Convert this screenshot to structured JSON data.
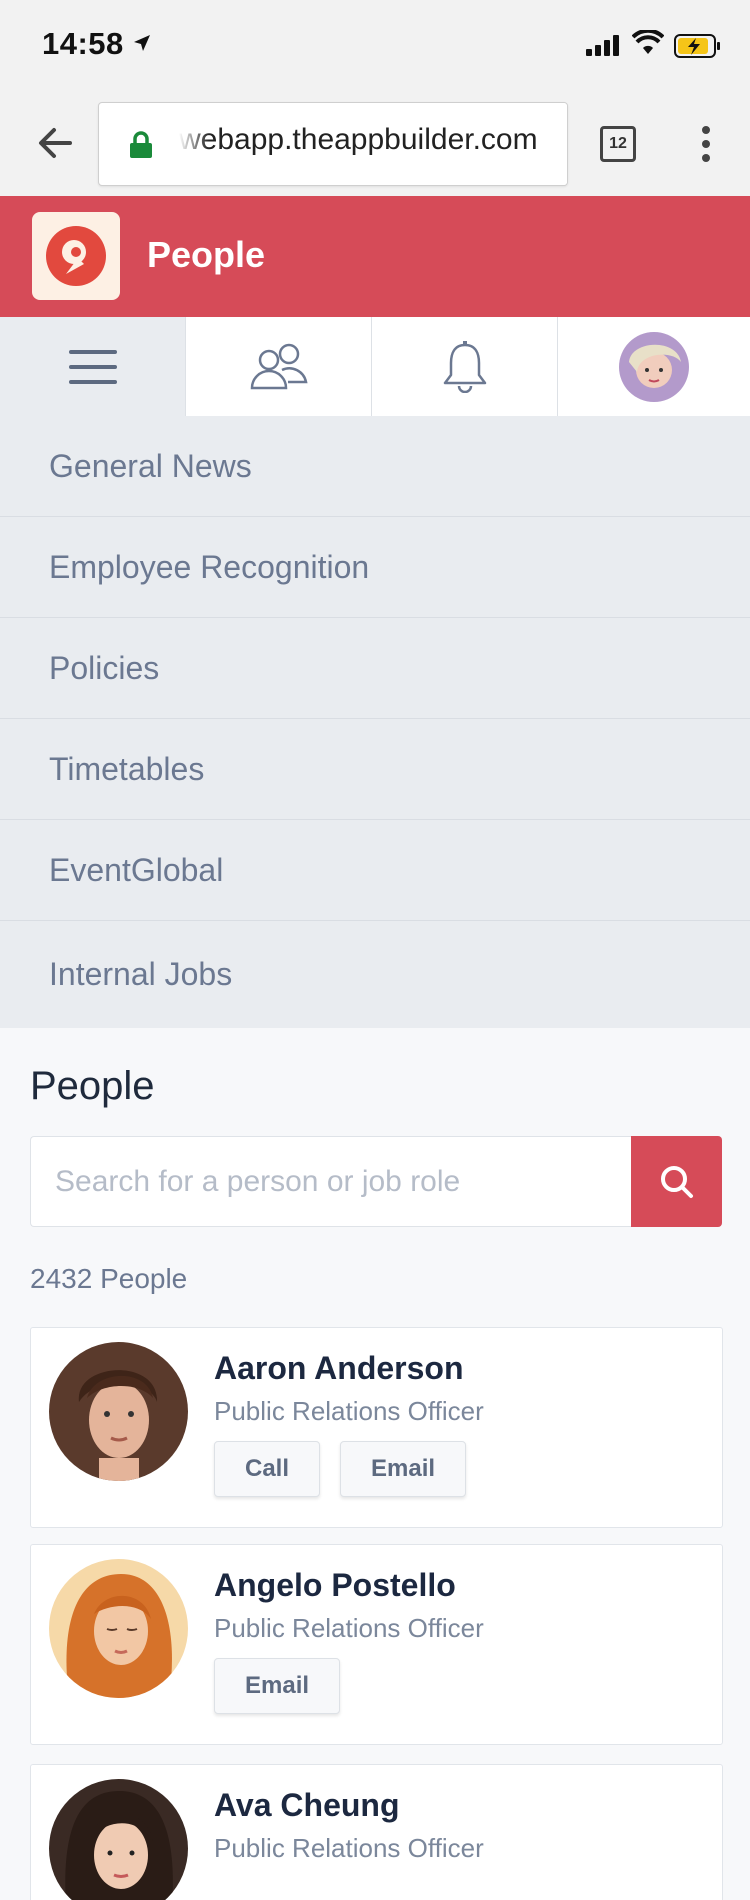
{
  "status_bar": {
    "time": "14:58"
  },
  "browser": {
    "url": "webapp.theappbuilder.com",
    "tab_count": "12"
  },
  "app": {
    "title": "People"
  },
  "menu": {
    "items": [
      {
        "label": "General News"
      },
      {
        "label": "Employee Recognition"
      },
      {
        "label": "Policies"
      },
      {
        "label": "Timetables"
      },
      {
        "label": "EventGlobal"
      },
      {
        "label": "Internal Jobs"
      }
    ]
  },
  "people": {
    "title": "People",
    "search_placeholder": "Search for a person or job role",
    "count": "2432 People",
    "list": [
      {
        "name": "Aaron Anderson",
        "role": "Public Relations Officer",
        "call_label": "Call",
        "email_label": "Email"
      },
      {
        "name": "Angelo Postello",
        "role": "Public Relations Officer",
        "email_label": "Email"
      },
      {
        "name": "Ava Cheung",
        "role": "Public Relations Officer"
      }
    ]
  },
  "colors": {
    "brand": "#d64b58",
    "menu_bg": "#e9ecf0",
    "menu_text": "#6b7891"
  }
}
